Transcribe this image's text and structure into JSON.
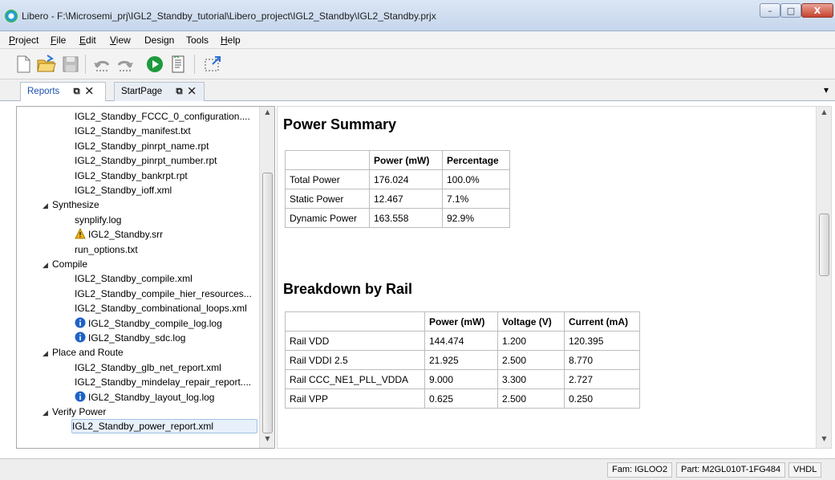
{
  "window": {
    "title": "Libero - F:\\Microsemi_prj\\IGL2_Standby_tutorial\\Libero_project\\IGL2_Standby\\IGL2_Standby.prjx",
    "min_label": "–",
    "max_label": "□",
    "close_label": "X"
  },
  "menu": [
    {
      "label": "Project",
      "mnemonic": "P",
      "rest": "roject"
    },
    {
      "label": "File",
      "mnemonic": "F",
      "rest": "ile"
    },
    {
      "label": "Edit",
      "mnemonic": "E",
      "rest": "dit"
    },
    {
      "label": "View",
      "mnemonic": "V",
      "rest": "iew"
    },
    {
      "label": "Design",
      "mnemonic": "",
      "rest": "Design"
    },
    {
      "label": "Tools",
      "mnemonic": "",
      "rest": "Tools"
    },
    {
      "label": "Help",
      "mnemonic": "H",
      "rest": "elp"
    }
  ],
  "toolbar": {
    "icons": [
      "new-file-icon",
      "open-folder-icon",
      "save-icon",
      "undo-icon",
      "redo-icon",
      "run-icon",
      "report-icon",
      "select-region-icon"
    ]
  },
  "tabs": [
    {
      "label": "Reports",
      "controls": "⧉ ✕",
      "active": true
    },
    {
      "label": "StartPage",
      "controls": "⧉ ✕",
      "active": false
    }
  ],
  "tabstrip_more": "▾",
  "tree": {
    "rows": [
      {
        "label": "IGL2_Standby_FCCC_0_configuration....",
        "indent": 2,
        "icon": "",
        "group": false
      },
      {
        "label": "IGL2_Standby_manifest.txt",
        "indent": 2,
        "icon": "",
        "group": false
      },
      {
        "label": "IGL2_Standby_pinrpt_name.rpt",
        "indent": 2,
        "icon": "",
        "group": false
      },
      {
        "label": "IGL2_Standby_pinrpt_number.rpt",
        "indent": 2,
        "icon": "",
        "group": false
      },
      {
        "label": "IGL2_Standby_bankrpt.rpt",
        "indent": 2,
        "icon": "",
        "group": false
      },
      {
        "label": "IGL2_Standby_ioff.xml",
        "indent": 2,
        "icon": "",
        "group": false
      },
      {
        "label": "Synthesize",
        "indent": 1,
        "icon": "",
        "group": true
      },
      {
        "label": "synplify.log",
        "indent": 2,
        "icon": "",
        "group": false
      },
      {
        "label": "IGL2_Standby.srr",
        "indent": 2,
        "icon": "warning-icon",
        "group": false
      },
      {
        "label": "run_options.txt",
        "indent": 2,
        "icon": "",
        "group": false
      },
      {
        "label": "Compile",
        "indent": 1,
        "icon": "",
        "group": true
      },
      {
        "label": "IGL2_Standby_compile.xml",
        "indent": 2,
        "icon": "",
        "group": false
      },
      {
        "label": "IGL2_Standby_compile_hier_resources...",
        "indent": 2,
        "icon": "",
        "group": false
      },
      {
        "label": "IGL2_Standby_combinational_loops.xml",
        "indent": 2,
        "icon": "",
        "group": false
      },
      {
        "label": "IGL2_Standby_compile_log.log",
        "indent": 2,
        "icon": "info-icon",
        "group": false
      },
      {
        "label": "IGL2_Standby_sdc.log",
        "indent": 2,
        "icon": "info-icon",
        "group": false
      },
      {
        "label": "Place and Route",
        "indent": 1,
        "icon": "",
        "group": true
      },
      {
        "label": "IGL2_Standby_glb_net_report.xml",
        "indent": 2,
        "icon": "",
        "group": false
      },
      {
        "label": "IGL2_Standby_mindelay_repair_report....",
        "indent": 2,
        "icon": "",
        "group": false
      },
      {
        "label": "IGL2_Standby_layout_log.log",
        "indent": 2,
        "icon": "info-icon",
        "group": false
      },
      {
        "label": "Verify Power",
        "indent": 1,
        "icon": "",
        "group": true
      },
      {
        "label": "IGL2_Standby_power_report.xml",
        "indent": 2,
        "icon": "",
        "group": false,
        "selected": true
      }
    ]
  },
  "report": {
    "summary_title": "Power Summary",
    "summary_headers": [
      "",
      "Power (mW)",
      "Percentage"
    ],
    "summary_rows": [
      [
        "Total Power",
        "176.024",
        "100.0%"
      ],
      [
        "Static Power",
        "12.467",
        "7.1%"
      ],
      [
        "Dynamic Power",
        "163.558",
        "92.9%"
      ]
    ],
    "rail_title": "Breakdown by Rail",
    "rail_headers": [
      "",
      "Power (mW)",
      "Voltage (V)",
      "Current (mA)"
    ],
    "rail_rows": [
      [
        "Rail VDD",
        "144.474",
        "1.200",
        "120.395"
      ],
      [
        "Rail VDDI 2.5",
        "21.925",
        "2.500",
        "8.770"
      ],
      [
        "Rail CCC_NE1_PLL_VDDA",
        "9.000",
        "3.300",
        "2.727"
      ],
      [
        "Rail VPP",
        "0.625",
        "2.500",
        "0.250"
      ]
    ]
  },
  "status": {
    "family": "Fam: IGLOO2",
    "part": "Part: M2GL010T-1FG484",
    "hdl": "VHDL"
  },
  "colors": {
    "accent": "#1a4fb3",
    "selection": "#e7f0fb",
    "warning": "#f2b20f",
    "info": "#1f62c5"
  }
}
